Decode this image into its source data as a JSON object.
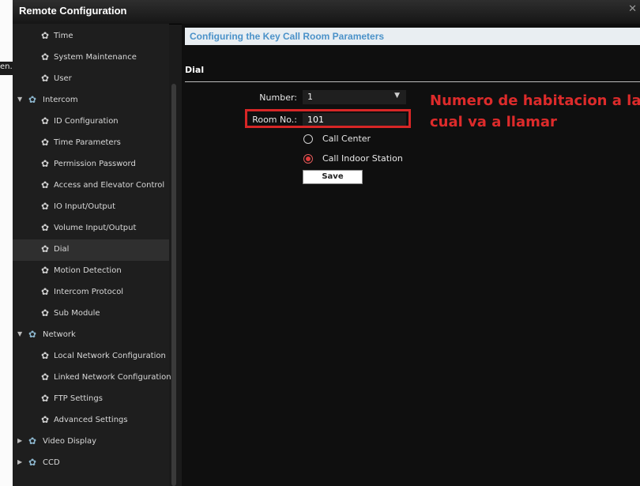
{
  "window": {
    "title": "Remote Configuration",
    "close_glyph": "✕"
  },
  "left_fragment": "en...",
  "sidebar": {
    "items": [
      {
        "label": "Time",
        "level": 2,
        "icon": "gear-icon"
      },
      {
        "label": "System Maintenance",
        "level": 2,
        "icon": "gear-icon"
      },
      {
        "label": "User",
        "level": 2,
        "icon": "gear-icon"
      },
      {
        "label": "Intercom",
        "level": 1,
        "icon": "group-gear-icon",
        "expanded": true
      },
      {
        "label": "ID Configuration",
        "level": 2,
        "icon": "gear-icon"
      },
      {
        "label": "Time Parameters",
        "level": 2,
        "icon": "gear-icon"
      },
      {
        "label": "Permission Password",
        "level": 2,
        "icon": "gear-icon"
      },
      {
        "label": "Access and Elevator Control",
        "level": 2,
        "icon": "gear-icon"
      },
      {
        "label": "IO Input/Output",
        "level": 2,
        "icon": "gear-icon"
      },
      {
        "label": "Volume Input/Output",
        "level": 2,
        "icon": "gear-icon"
      },
      {
        "label": "Dial",
        "level": 2,
        "icon": "gear-icon",
        "selected": true
      },
      {
        "label": "Motion Detection",
        "level": 2,
        "icon": "gear-icon"
      },
      {
        "label": "Intercom Protocol",
        "level": 2,
        "icon": "gear-icon"
      },
      {
        "label": "Sub Module",
        "level": 2,
        "icon": "gear-icon"
      },
      {
        "label": "Network",
        "level": 1,
        "icon": "group-gear-icon",
        "expanded": true
      },
      {
        "label": "Local Network Configuration",
        "level": 2,
        "icon": "gear-icon"
      },
      {
        "label": "Linked Network Configuration",
        "level": 2,
        "icon": "gear-icon"
      },
      {
        "label": "FTP Settings",
        "level": 2,
        "icon": "gear-icon"
      },
      {
        "label": "Advanced Settings",
        "level": 2,
        "icon": "gear-icon"
      },
      {
        "label": "Video Display",
        "level": 1,
        "icon": "group-gear-icon",
        "expanded": false
      },
      {
        "label": "CCD",
        "level": 1,
        "icon": "group-gear-icon",
        "expanded": false
      }
    ]
  },
  "main": {
    "header": "Configuring the Key Call Room Parameters",
    "section": "Dial",
    "number": {
      "label": "Number:",
      "value": "1"
    },
    "room": {
      "label": "Room No.:",
      "value": "101"
    },
    "radio_call_center": "Call Center",
    "radio_call_indoor": "Call Indoor Station",
    "selected_radio": "Call Indoor Station",
    "save_label": "Save"
  },
  "annotation": {
    "text": "Numero de habitacion a la cual va a llamar",
    "color": "#dd2b2b"
  },
  "colors": {
    "accent": "#4b92c9",
    "annotation": "#d72626",
    "background": "#1b1b1b"
  }
}
